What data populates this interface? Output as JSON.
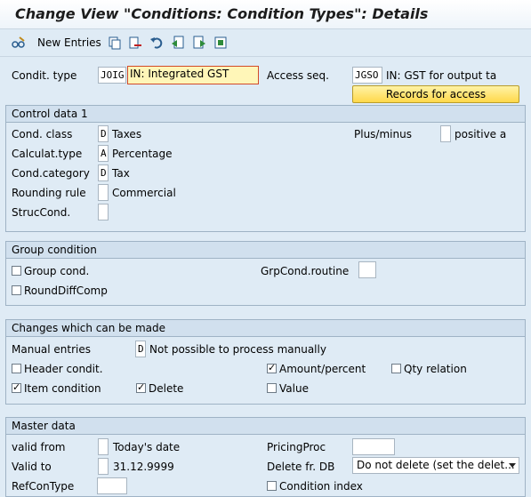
{
  "title": "Change View \"Conditions: Condition Types\": Details",
  "toolbar": {
    "new_entries": "New Entries"
  },
  "header": {
    "condit_type_label": "Condit. type",
    "condit_type_code": "JOIG",
    "condit_type_desc": "IN: Integrated GST",
    "access_seq_label": "Access seq.",
    "access_seq_code": "JGSO",
    "access_seq_desc": "IN: GST for output ta",
    "records_button": "Records for access"
  },
  "control": {
    "title": "Control data 1",
    "cond_class_label": "Cond. class",
    "cond_class_code": "D",
    "cond_class_text": "Taxes",
    "calc_type_label": "Calculat.type",
    "calc_type_code": "A",
    "calc_type_text": "Percentage",
    "cond_cat_label": "Cond.category",
    "cond_cat_code": "D",
    "cond_cat_text": "Tax",
    "rounding_label": "Rounding rule",
    "rounding_code": "",
    "rounding_text": "Commercial",
    "struc_label": "StrucCond.",
    "struc_code": "",
    "plusminus_label": "Plus/minus",
    "plusminus_code": "",
    "plusminus_text": "positive a"
  },
  "group": {
    "title": "Group condition",
    "group_cond": "Group cond.",
    "round_diff": "RoundDiffComp",
    "routine_label": "GrpCond.routine",
    "routine_value": ""
  },
  "changes": {
    "title": "Changes which can be made",
    "manual_label": "Manual entries",
    "manual_code": "D",
    "manual_text": "Not possible to process manually",
    "header_condit": "Header condit.",
    "amount_percent": "Amount/percent",
    "qty_relation": "Qty relation",
    "item_condition": "Item condition",
    "delete": "Delete",
    "value": "Value",
    "checked": {
      "header_condit": false,
      "amount_percent": true,
      "qty_relation": false,
      "item_condition": true,
      "delete": true,
      "value": false
    }
  },
  "master": {
    "title": "Master data",
    "valid_from_label": "valid from",
    "valid_from_text": "Today's date",
    "valid_to_label": "Valid to",
    "valid_to_text": "31.12.9999",
    "refcon_label": "RefConType",
    "pricing_label": "PricingProc",
    "pricing_value": "",
    "delete_db_label": "Delete fr. DB",
    "delete_db_value": "Do not delete (set the delet...",
    "cond_index": "Condition index"
  }
}
